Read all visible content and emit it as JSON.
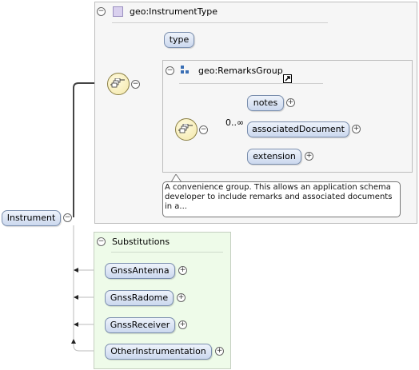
{
  "root": {
    "label": "Instrument"
  },
  "complex_type": {
    "title": "geo:InstrumentType"
  },
  "type_element": {
    "label": "type"
  },
  "group": {
    "title": "geo:RemarksGroup",
    "cardinality": "0..∞",
    "elements": [
      {
        "label": "notes"
      },
      {
        "label": "associatedDocument"
      },
      {
        "label": "extension"
      }
    ],
    "annotation": [
      "A convenience group. This allows an application schema",
      "developer to include remarks and associated documents",
      "in a..."
    ]
  },
  "substitutions": {
    "title": "Substitutions",
    "items": [
      {
        "label": "GnssAntenna"
      },
      {
        "label": "GnssRadome"
      },
      {
        "label": "GnssReceiver"
      },
      {
        "label": "OtherInstrumentation"
      }
    ]
  },
  "icons": {
    "collapse": "minus-circle-icon",
    "expand": "plus-circle-icon",
    "sequence": "sequence-compositor-icon",
    "type": "complex-type-icon",
    "group": "model-group-icon",
    "link": "external-link-icon"
  },
  "colors": {
    "element_fill": "#cbd8ee",
    "element_border": "#7b8fae",
    "compositor_fill": "#f3e7a8",
    "substitution_bg": "#eefbe9",
    "container_bg": "#f6f6f6"
  }
}
